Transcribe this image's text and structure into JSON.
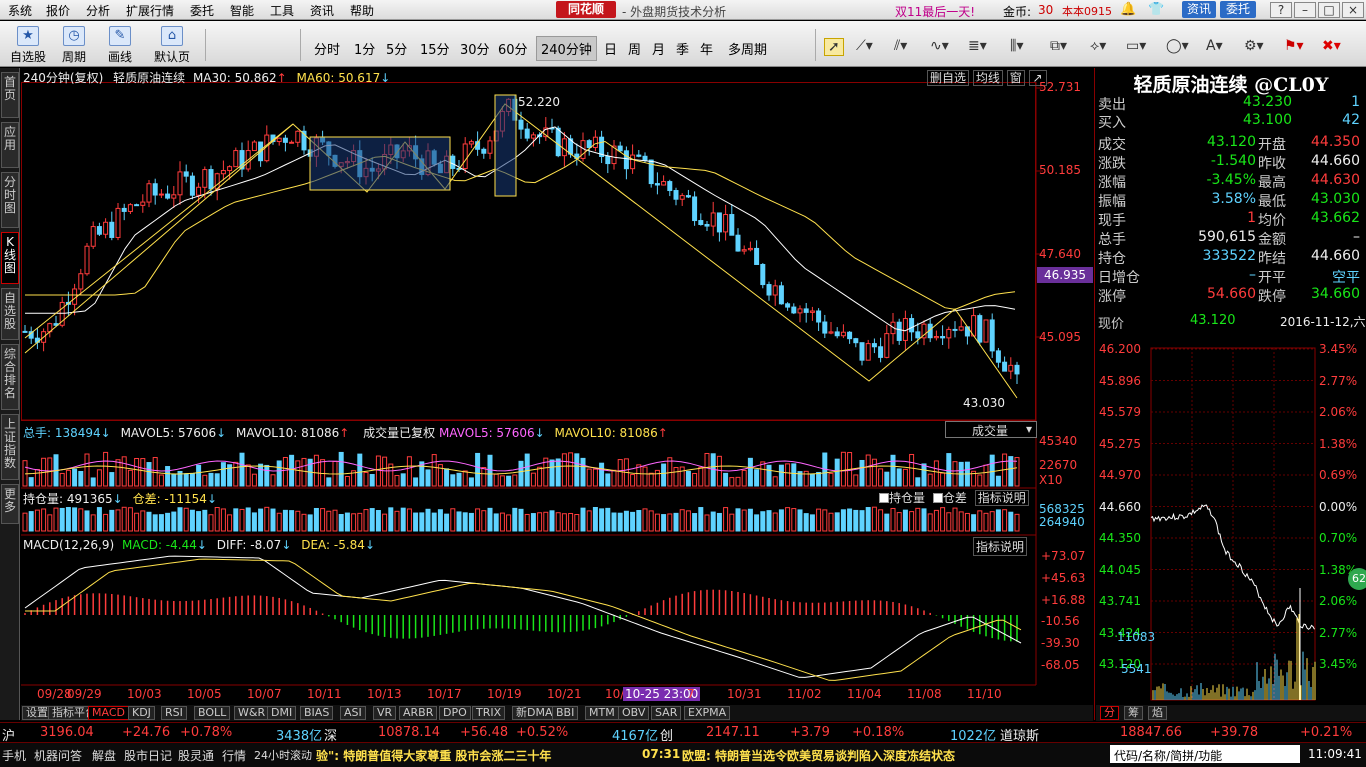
{
  "menu": [
    "系统",
    "报价",
    "分析",
    "扩展行情",
    "委托",
    "智能",
    "工具",
    "资讯",
    "帮助"
  ],
  "brand": "同花顺",
  "subtitle": "- 外盘期货技术分析",
  "promo": "双11最后一天!",
  "coins_label": "金币:",
  "coins": "30",
  "version": "本本0915",
  "top_buttons": {
    "news": "资讯",
    "trust": "委托"
  },
  "toolbar": {
    "buttons": [
      {
        "label": "自选股",
        "icon": "star-icon"
      },
      {
        "label": "周期",
        "icon": "clock-icon"
      },
      {
        "label": "画线",
        "icon": "pen-icon"
      },
      {
        "label": "默认页",
        "icon": "home-icon"
      }
    ],
    "periods": [
      "分时",
      "1分",
      "5分",
      "15分",
      "30分",
      "60分",
      "240分钟",
      "日",
      "周",
      "月",
      "季",
      "年",
      "多周期"
    ],
    "active_period": "240分钟"
  },
  "left_tabs": [
    "首页",
    "应用",
    "分时图",
    "K线图",
    "自选股",
    "综合排名",
    "上证指数",
    "更多"
  ],
  "kline": {
    "header_period": "240分钟(复权)",
    "instrument": "轻质原油连续",
    "ma30": "MA30: 50.862",
    "ma60": "MA60: 50.617",
    "controls": [
      "删自选",
      "均线",
      "窗"
    ],
    "price_ticks": [
      "52.731",
      "50.185",
      "47.640",
      "45.095"
    ],
    "current_price_tag": "46.935",
    "high_label": "52.220",
    "low_label": "43.030"
  },
  "volume": {
    "total": "总手: 138494",
    "mavol5": "MAVOL5: 57606",
    "mavol10": "MAVOL10: 81086",
    "adj": "成交量已复权",
    "mavol5b": "MAVOL5: 57606",
    "mavol10b": "MAVOL10: 81086",
    "selector": "成交量",
    "ticks": [
      "45340",
      "22670",
      "X10"
    ]
  },
  "oi": {
    "label": "持仓量: 491365",
    "diff": "仓差: -11154",
    "cb_oi": "持仓量",
    "cb_diff": "仓差",
    "explain": "指标说明",
    "ticks": [
      "568325",
      "264940"
    ]
  },
  "macd": {
    "name": "MACD(12,26,9)",
    "macd": "MACD: -4.44",
    "diff": "DIFF: -8.07",
    "dea": "DEA: -5.84",
    "explain": "指标说明",
    "ticks": [
      "+73.07",
      "+45.63",
      "+16.88",
      "-10.56",
      "-39.30",
      "-68.05"
    ]
  },
  "dates": [
    "09/28",
    "09/29",
    "10/03",
    "10/05",
    "10/07",
    "10/11",
    "10/13",
    "10/17",
    "10/19",
    "10/21",
    "10/",
    "10-25 23:00",
    "7",
    "10/31",
    "11/02",
    "11/04",
    "11/08",
    "11/10"
  ],
  "bottom_tabs": [
    "设置",
    "指标平台",
    "MACD",
    "KDJ",
    "RSI",
    "BOLL",
    "W&R",
    "DMI",
    "BIAS",
    "ASI",
    "VR",
    "ARBR",
    "DPO",
    "TRIX",
    "新DMA",
    "BBI",
    "MTM",
    "OBV",
    "SAR",
    "EXPMA"
  ],
  "active_bottom_tab": "MACD",
  "quote": {
    "title": "轻质原油连续 @CL0Y",
    "rows": [
      [
        "卖出",
        "43.230",
        "",
        "1"
      ],
      [
        "买入",
        "43.100",
        "",
        "42"
      ]
    ],
    "grid": [
      [
        "成交",
        "43.120",
        "开盘",
        "44.350"
      ],
      [
        "涨跌",
        "-1.540",
        "昨收",
        "44.660"
      ],
      [
        "涨幅",
        "-3.45%",
        "最高",
        "44.630"
      ],
      [
        "振幅",
        "3.58%",
        "最低",
        "43.030"
      ],
      [
        "现手",
        "1",
        "均价",
        "43.662"
      ],
      [
        "总手",
        "590,615",
        "金额",
        "–"
      ],
      [
        "持仓",
        "333522",
        "昨结",
        "44.660"
      ],
      [
        "日增仓",
        "–",
        "开平",
        "空平"
      ],
      [
        "涨停",
        "54.660",
        "跌停",
        "34.660"
      ]
    ],
    "now_label": "现价",
    "now_value": "43.120",
    "date": "2016-11-12,六"
  },
  "intraday": {
    "left_ticks": [
      "46.200",
      "45.896",
      "45.579",
      "45.275",
      "44.970",
      "44.660",
      "44.350",
      "44.045",
      "43.741",
      "43.424",
      "43.120"
    ],
    "right_ticks": [
      "3.45%",
      "2.77%",
      "2.06%",
      "1.38%",
      "0.69%",
      "0.00%",
      "0.70%",
      "1.38%",
      "2.06%",
      "2.77%",
      "3.45%"
    ],
    "vol_ticks": [
      "11083",
      "5541"
    ],
    "badge": "62",
    "tabs": [
      "分",
      "筹",
      "焰"
    ]
  },
  "indices": {
    "sh_label": "沪",
    "sh": "3196.04",
    "sh_chg": "+24.76",
    "sh_pct": "+0.78%",
    "sh_amt": "3438亿",
    "sz_label": "深",
    "sz": "10878.14",
    "sz_chg": "+56.48",
    "sz_pct": "+0.52%",
    "sz_amt": "4167亿",
    "cy_label": "创",
    "cy": "2147.11",
    "cy_chg": "+3.79",
    "cy_pct": "+0.18%",
    "cy_amt": "1022亿",
    "dj_label": "道琼斯",
    "dj": "18847.66",
    "dj_chg": "+39.78",
    "dj_pct": "+0.21%"
  },
  "statusbar": {
    "items": [
      "手机",
      "机器问答",
      "解盘",
      "股市日记",
      "股灵通",
      "行情",
      "24小时滚动"
    ],
    "news1": "验\": 特朗普值得大家尊重  股市会涨二三十年",
    "news2_time": "07:31",
    "news2": "欧盟: 特朗普当选令欧美贸易谈判陷入深度冻结状态",
    "search": "代码/名称/简拼/功能",
    "clock": "11:09:41"
  }
}
